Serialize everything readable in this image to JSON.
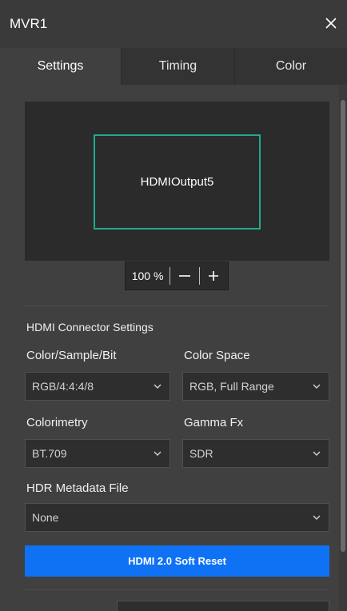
{
  "window": {
    "title": "MVR1",
    "close_icon": "close-icon"
  },
  "tabs": [
    {
      "label": "Settings",
      "active": true
    },
    {
      "label": "Timing",
      "active": false
    },
    {
      "label": "Color",
      "active": false
    }
  ],
  "preview": {
    "output_label": "HDMIOutput5",
    "border_color": "#22a98c"
  },
  "zoom": {
    "value": "100 %",
    "minus_icon": "minus-icon",
    "plus_icon": "plus-icon"
  },
  "hdmi_settings": {
    "section_title": "HDMI Connector Settings",
    "color_sample_bit": {
      "label": "Color/Sample/Bit",
      "value": "RGB/4:4:4/8"
    },
    "color_space": {
      "label": "Color Space",
      "value": "RGB, Full Range"
    },
    "colorimetry": {
      "label": "Colorimetry",
      "value": "BT.709"
    },
    "gamma_fx": {
      "label": "Gamma Fx",
      "value": "SDR"
    },
    "hdr_metadata": {
      "label": "HDR Metadata File",
      "value": "None"
    },
    "reset_button": {
      "label": "HDMI 2.0 Soft Reset",
      "color": "#0f72f5"
    }
  }
}
